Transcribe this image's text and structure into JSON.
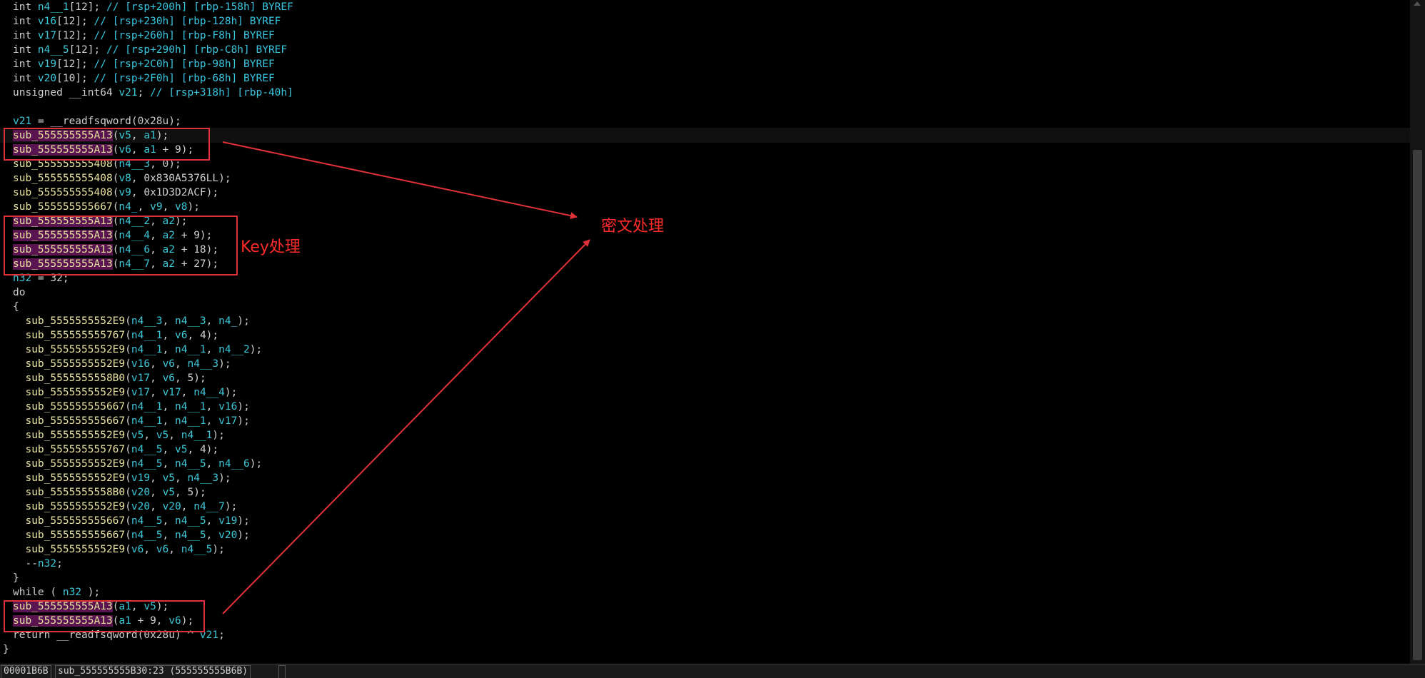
{
  "code_lines": [
    [
      [
        "kw",
        "int "
      ],
      [
        "var",
        "n4__1"
      ],
      [
        "txt",
        "[12]; "
      ],
      [
        "cmt",
        "// [rsp+200h] [rbp-158h] BYREF"
      ]
    ],
    [
      [
        "kw",
        "int "
      ],
      [
        "var",
        "v16"
      ],
      [
        "txt",
        "[12]; "
      ],
      [
        "cmt",
        "// [rsp+230h] [rbp-128h] BYREF"
      ]
    ],
    [
      [
        "kw",
        "int "
      ],
      [
        "var",
        "v17"
      ],
      [
        "txt",
        "[12]; "
      ],
      [
        "cmt",
        "// [rsp+260h] [rbp-F8h] BYREF"
      ]
    ],
    [
      [
        "kw",
        "int "
      ],
      [
        "var",
        "n4__5"
      ],
      [
        "txt",
        "[12]; "
      ],
      [
        "cmt",
        "// [rsp+290h] [rbp-C8h] BYREF"
      ]
    ],
    [
      [
        "kw",
        "int "
      ],
      [
        "var",
        "v19"
      ],
      [
        "txt",
        "[12]; "
      ],
      [
        "cmt",
        "// [rsp+2C0h] [rbp-98h] BYREF"
      ]
    ],
    [
      [
        "kw",
        "int "
      ],
      [
        "var",
        "v20"
      ],
      [
        "txt",
        "[10]; "
      ],
      [
        "cmt",
        "// [rsp+2F0h] [rbp-68h] BYREF"
      ]
    ],
    [
      [
        "kw",
        "unsigned __int64 "
      ],
      [
        "var",
        "v21"
      ],
      [
        "txt",
        "; "
      ],
      [
        "cmt",
        "// [rsp+318h] [rbp-40h]"
      ]
    ],
    [],
    [
      [
        "var",
        "v21"
      ],
      [
        "txt",
        " = __readfsqword("
      ],
      [
        "num",
        "0x28u"
      ],
      [
        "txt",
        ");"
      ]
    ],
    [
      [
        "fnhl",
        "sub_555555555A13"
      ],
      [
        "txt",
        "("
      ],
      [
        "var",
        "v5"
      ],
      [
        "txt",
        ", "
      ],
      [
        "var",
        "a1"
      ],
      [
        "txt",
        ");"
      ]
    ],
    [
      [
        "fnhl",
        "sub_555555555A13"
      ],
      [
        "txt",
        "("
      ],
      [
        "var",
        "v6"
      ],
      [
        "txt",
        ", "
      ],
      [
        "var",
        "a1"
      ],
      [
        "txt",
        " + 9);"
      ]
    ],
    [
      [
        "fn",
        "sub_555555555408"
      ],
      [
        "txt",
        "("
      ],
      [
        "var",
        "n4__3"
      ],
      [
        "txt",
        ", 0);"
      ]
    ],
    [
      [
        "fn",
        "sub_555555555408"
      ],
      [
        "txt",
        "("
      ],
      [
        "var",
        "v8"
      ],
      [
        "txt",
        ", 0x830A5376LL);"
      ]
    ],
    [
      [
        "fn",
        "sub_555555555408"
      ],
      [
        "txt",
        "("
      ],
      [
        "var",
        "v9"
      ],
      [
        "txt",
        ", 0x1D3D2ACF);"
      ]
    ],
    [
      [
        "fn",
        "sub_555555555667"
      ],
      [
        "txt",
        "("
      ],
      [
        "var",
        "n4_"
      ],
      [
        "txt",
        ", "
      ],
      [
        "var",
        "v9"
      ],
      [
        "txt",
        ", "
      ],
      [
        "var",
        "v8"
      ],
      [
        "txt",
        ");"
      ]
    ],
    [
      [
        "fnhl",
        "sub_555555555A13"
      ],
      [
        "txt",
        "("
      ],
      [
        "var",
        "n4__2"
      ],
      [
        "txt",
        ", "
      ],
      [
        "var",
        "a2"
      ],
      [
        "txt",
        ");"
      ]
    ],
    [
      [
        "fnhl",
        "sub_555555555A13"
      ],
      [
        "txt",
        "("
      ],
      [
        "var",
        "n4__4"
      ],
      [
        "txt",
        ", "
      ],
      [
        "var",
        "a2"
      ],
      [
        "txt",
        " + 9);"
      ]
    ],
    [
      [
        "fnhl",
        "sub_555555555A13"
      ],
      [
        "txt",
        "("
      ],
      [
        "var",
        "n4__6"
      ],
      [
        "txt",
        ", "
      ],
      [
        "var",
        "a2"
      ],
      [
        "txt",
        " + 18);"
      ]
    ],
    [
      [
        "fnhl",
        "sub_555555555A13"
      ],
      [
        "txt",
        "("
      ],
      [
        "var",
        "n4__7"
      ],
      [
        "txt",
        ", "
      ],
      [
        "var",
        "a2"
      ],
      [
        "txt",
        " + 27);"
      ]
    ],
    [
      [
        "var",
        "n32"
      ],
      [
        "txt",
        " = 32;"
      ]
    ],
    [
      [
        "kw",
        "do"
      ]
    ],
    [
      [
        "txt",
        "{"
      ]
    ],
    [
      [
        "txt",
        "  "
      ],
      [
        "fn",
        "sub_5555555552E9"
      ],
      [
        "txt",
        "("
      ],
      [
        "var",
        "n4__3"
      ],
      [
        "txt",
        ", "
      ],
      [
        "var",
        "n4__3"
      ],
      [
        "txt",
        ", "
      ],
      [
        "var",
        "n4_"
      ],
      [
        "txt",
        ");"
      ]
    ],
    [
      [
        "txt",
        "  "
      ],
      [
        "fn",
        "sub_555555555767"
      ],
      [
        "txt",
        "("
      ],
      [
        "var",
        "n4__1"
      ],
      [
        "txt",
        ", "
      ],
      [
        "var",
        "v6"
      ],
      [
        "txt",
        ", 4);"
      ]
    ],
    [
      [
        "txt",
        "  "
      ],
      [
        "fn",
        "sub_5555555552E9"
      ],
      [
        "txt",
        "("
      ],
      [
        "var",
        "n4__1"
      ],
      [
        "txt",
        ", "
      ],
      [
        "var",
        "n4__1"
      ],
      [
        "txt",
        ", "
      ],
      [
        "var",
        "n4__2"
      ],
      [
        "txt",
        ");"
      ]
    ],
    [
      [
        "txt",
        "  "
      ],
      [
        "fn",
        "sub_5555555552E9"
      ],
      [
        "txt",
        "("
      ],
      [
        "var",
        "v16"
      ],
      [
        "txt",
        ", "
      ],
      [
        "var",
        "v6"
      ],
      [
        "txt",
        ", "
      ],
      [
        "var",
        "n4__3"
      ],
      [
        "txt",
        ");"
      ]
    ],
    [
      [
        "txt",
        "  "
      ],
      [
        "fn",
        "sub_5555555558B0"
      ],
      [
        "txt",
        "("
      ],
      [
        "var",
        "v17"
      ],
      [
        "txt",
        ", "
      ],
      [
        "var",
        "v6"
      ],
      [
        "txt",
        ", 5);"
      ]
    ],
    [
      [
        "txt",
        "  "
      ],
      [
        "fn",
        "sub_5555555552E9"
      ],
      [
        "txt",
        "("
      ],
      [
        "var",
        "v17"
      ],
      [
        "txt",
        ", "
      ],
      [
        "var",
        "v17"
      ],
      [
        "txt",
        ", "
      ],
      [
        "var",
        "n4__4"
      ],
      [
        "txt",
        ");"
      ]
    ],
    [
      [
        "txt",
        "  "
      ],
      [
        "fn",
        "sub_555555555667"
      ],
      [
        "txt",
        "("
      ],
      [
        "var",
        "n4__1"
      ],
      [
        "txt",
        ", "
      ],
      [
        "var",
        "n4__1"
      ],
      [
        "txt",
        ", "
      ],
      [
        "var",
        "v16"
      ],
      [
        "txt",
        ");"
      ]
    ],
    [
      [
        "txt",
        "  "
      ],
      [
        "fn",
        "sub_555555555667"
      ],
      [
        "txt",
        "("
      ],
      [
        "var",
        "n4__1"
      ],
      [
        "txt",
        ", "
      ],
      [
        "var",
        "n4__1"
      ],
      [
        "txt",
        ", "
      ],
      [
        "var",
        "v17"
      ],
      [
        "txt",
        ");"
      ]
    ],
    [
      [
        "txt",
        "  "
      ],
      [
        "fn",
        "sub_5555555552E9"
      ],
      [
        "txt",
        "("
      ],
      [
        "var",
        "v5"
      ],
      [
        "txt",
        ", "
      ],
      [
        "var",
        "v5"
      ],
      [
        "txt",
        ", "
      ],
      [
        "var",
        "n4__1"
      ],
      [
        "txt",
        ");"
      ]
    ],
    [
      [
        "txt",
        "  "
      ],
      [
        "fn",
        "sub_555555555767"
      ],
      [
        "txt",
        "("
      ],
      [
        "var",
        "n4__5"
      ],
      [
        "txt",
        ", "
      ],
      [
        "var",
        "v5"
      ],
      [
        "txt",
        ", 4);"
      ]
    ],
    [
      [
        "txt",
        "  "
      ],
      [
        "fn",
        "sub_5555555552E9"
      ],
      [
        "txt",
        "("
      ],
      [
        "var",
        "n4__5"
      ],
      [
        "txt",
        ", "
      ],
      [
        "var",
        "n4__5"
      ],
      [
        "txt",
        ", "
      ],
      [
        "var",
        "n4__6"
      ],
      [
        "txt",
        ");"
      ]
    ],
    [
      [
        "txt",
        "  "
      ],
      [
        "fn",
        "sub_5555555552E9"
      ],
      [
        "txt",
        "("
      ],
      [
        "var",
        "v19"
      ],
      [
        "txt",
        ", "
      ],
      [
        "var",
        "v5"
      ],
      [
        "txt",
        ", "
      ],
      [
        "var",
        "n4__3"
      ],
      [
        "txt",
        ");"
      ]
    ],
    [
      [
        "txt",
        "  "
      ],
      [
        "fn",
        "sub_5555555558B0"
      ],
      [
        "txt",
        "("
      ],
      [
        "var",
        "v20"
      ],
      [
        "txt",
        ", "
      ],
      [
        "var",
        "v5"
      ],
      [
        "txt",
        ", 5);"
      ]
    ],
    [
      [
        "txt",
        "  "
      ],
      [
        "fn",
        "sub_5555555552E9"
      ],
      [
        "txt",
        "("
      ],
      [
        "var",
        "v20"
      ],
      [
        "txt",
        ", "
      ],
      [
        "var",
        "v20"
      ],
      [
        "txt",
        ", "
      ],
      [
        "var",
        "n4__7"
      ],
      [
        "txt",
        ");"
      ]
    ],
    [
      [
        "txt",
        "  "
      ],
      [
        "fn",
        "sub_555555555667"
      ],
      [
        "txt",
        "("
      ],
      [
        "var",
        "n4__5"
      ],
      [
        "txt",
        ", "
      ],
      [
        "var",
        "n4__5"
      ],
      [
        "txt",
        ", "
      ],
      [
        "var",
        "v19"
      ],
      [
        "txt",
        ");"
      ]
    ],
    [
      [
        "txt",
        "  "
      ],
      [
        "fn",
        "sub_555555555667"
      ],
      [
        "txt",
        "("
      ],
      [
        "var",
        "n4__5"
      ],
      [
        "txt",
        ", "
      ],
      [
        "var",
        "n4__5"
      ],
      [
        "txt",
        ", "
      ],
      [
        "var",
        "v20"
      ],
      [
        "txt",
        ");"
      ]
    ],
    [
      [
        "txt",
        "  "
      ],
      [
        "fn",
        "sub_5555555552E9"
      ],
      [
        "txt",
        "("
      ],
      [
        "var",
        "v6"
      ],
      [
        "txt",
        ", "
      ],
      [
        "var",
        "v6"
      ],
      [
        "txt",
        ", "
      ],
      [
        "var",
        "n4__5"
      ],
      [
        "txt",
        ");"
      ]
    ],
    [
      [
        "txt",
        "  --"
      ],
      [
        "var",
        "n32"
      ],
      [
        "txt",
        ";"
      ]
    ],
    [
      [
        "txt",
        "}"
      ]
    ],
    [
      [
        "kw",
        "while"
      ],
      [
        "txt",
        " ( "
      ],
      [
        "var",
        "n32"
      ],
      [
        "txt",
        " );"
      ]
    ],
    [
      [
        "fnhl",
        "sub_555555555A13"
      ],
      [
        "txt",
        "("
      ],
      [
        "var",
        "a1"
      ],
      [
        "txt",
        ", "
      ],
      [
        "var",
        "v5"
      ],
      [
        "txt",
        ");"
      ]
    ],
    [
      [
        "fnhl",
        "sub_555555555A13"
      ],
      [
        "txt",
        "("
      ],
      [
        "var",
        "a1"
      ],
      [
        "txt",
        " + 9, "
      ],
      [
        "var",
        "v6"
      ],
      [
        "txt",
        ");"
      ]
    ],
    [
      [
        "kw",
        "return"
      ],
      [
        "txt",
        " __readfsqword(0x28u) ^ "
      ],
      [
        "var",
        "v21"
      ],
      [
        "txt",
        ";"
      ]
    ]
  ],
  "closing_brace": "}",
  "annotations": {
    "key_label": "Key处理",
    "cipher_label": "密文处理"
  },
  "status": {
    "offset": "00001B6B",
    "location": "sub_555555555B30:23 (555555555B6B)"
  },
  "colors": {
    "background": "#000000",
    "annotation": "#e0313b"
  }
}
